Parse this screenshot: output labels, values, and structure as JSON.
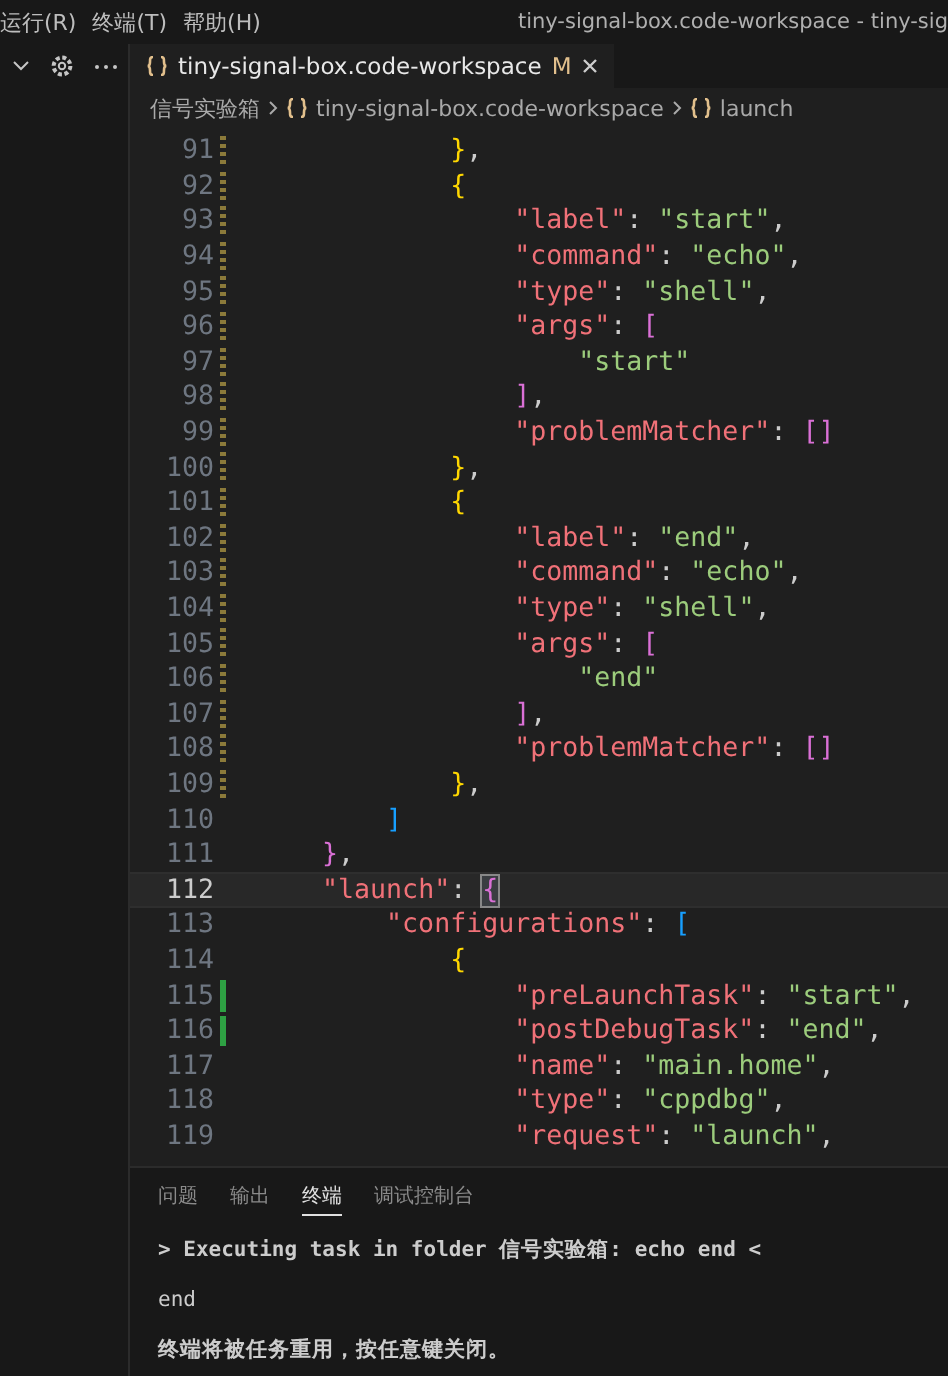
{
  "menu": [
    "运行(R)",
    "终端(T)",
    "帮助(H)"
  ],
  "window": {
    "title": "tiny-signal-box.code-workspace - tiny-sig"
  },
  "tabs": [
    {
      "label": "tiny-signal-box.code-workspace",
      "badge": "M",
      "selected": true
    }
  ],
  "breadcrumb": [
    {
      "label": "信号实验箱",
      "icon": false
    },
    {
      "label": "tiny-signal-box.code-workspace",
      "icon": true
    },
    {
      "label": "launch",
      "icon": true
    }
  ],
  "editor": {
    "lines": [
      {
        "number": "91",
        "modified": true,
        "tokens": [
          {
            "t": "}",
            "kind": "b1"
          },
          {
            "t": ","
          }
        ]
      },
      {
        "number": "92",
        "modified": true,
        "tokens": [
          {
            "t": "{",
            "kind": "b1"
          }
        ]
      },
      {
        "number": "93",
        "modified": true,
        "tokens": [
          {
            "t": "\"label\"",
            "kind": "key"
          },
          {
            "t": ": "
          },
          {
            "t": "\"start\"",
            "kind": "str"
          },
          {
            "t": ","
          }
        ]
      },
      {
        "number": "94",
        "modified": true,
        "tokens": [
          {
            "t": "\"command\"",
            "kind": "key"
          },
          {
            "t": ": "
          },
          {
            "t": "\"echo\"",
            "kind": "str"
          },
          {
            "t": ","
          }
        ]
      },
      {
        "number": "95",
        "modified": true,
        "tokens": [
          {
            "t": "\"type\"",
            "kind": "key"
          },
          {
            "t": ": "
          },
          {
            "t": "\"shell\"",
            "kind": "str"
          },
          {
            "t": ","
          }
        ]
      },
      {
        "number": "96",
        "modified": true,
        "tokens": [
          {
            "t": "\"args\"",
            "kind": "key"
          },
          {
            "t": ": "
          },
          {
            "t": "[",
            "kind": "b2"
          }
        ]
      },
      {
        "number": "97",
        "modified": true,
        "tokens": [
          {
            "t": "\"start\"",
            "kind": "str"
          }
        ]
      },
      {
        "number": "98",
        "modified": true,
        "tokens": [
          {
            "t": "]",
            "kind": "b2"
          },
          {
            "t": ","
          }
        ]
      },
      {
        "number": "99",
        "modified": true,
        "tokens": [
          {
            "t": "\"problemMatcher\"",
            "kind": "key"
          },
          {
            "t": ": "
          },
          {
            "t": "[]",
            "kind": "b2"
          }
        ]
      },
      {
        "number": "100",
        "modified": true,
        "tokens": [
          {
            "t": "}",
            "kind": "b1"
          },
          {
            "t": ","
          }
        ]
      },
      {
        "number": "101",
        "modified": true,
        "tokens": [
          {
            "t": "{",
            "kind": "b1"
          }
        ]
      },
      {
        "number": "102",
        "modified": true,
        "tokens": [
          {
            "t": "\"label\"",
            "kind": "key"
          },
          {
            "t": ": "
          },
          {
            "t": "\"end\"",
            "kind": "str"
          },
          {
            "t": ","
          }
        ]
      },
      {
        "number": "103",
        "modified": true,
        "tokens": [
          {
            "t": "\"command\"",
            "kind": "key"
          },
          {
            "t": ": "
          },
          {
            "t": "\"echo\"",
            "kind": "str"
          },
          {
            "t": ","
          }
        ]
      },
      {
        "number": "104",
        "modified": true,
        "tokens": [
          {
            "t": "\"type\"",
            "kind": "key"
          },
          {
            "t": ": "
          },
          {
            "t": "\"shell\"",
            "kind": "str"
          },
          {
            "t": ","
          }
        ]
      },
      {
        "number": "105",
        "modified": true,
        "tokens": [
          {
            "t": "\"args\"",
            "kind": "key"
          },
          {
            "t": ": "
          },
          {
            "t": "[",
            "kind": "b2"
          }
        ]
      },
      {
        "number": "106",
        "modified": true,
        "tokens": [
          {
            "t": "\"end\"",
            "kind": "str"
          }
        ]
      },
      {
        "number": "107",
        "modified": true,
        "tokens": [
          {
            "t": "]",
            "kind": "b2"
          },
          {
            "t": ","
          }
        ]
      },
      {
        "number": "108",
        "modified": true,
        "tokens": [
          {
            "t": "\"problemMatcher\"",
            "kind": "key"
          },
          {
            "t": ": "
          },
          {
            "t": "[]",
            "kind": "b2"
          }
        ]
      },
      {
        "number": "109",
        "modified": true,
        "tokens": [
          {
            "t": "}",
            "kind": "b1"
          },
          {
            "t": ","
          }
        ]
      },
      {
        "number": "110",
        "tokens": [
          {
            "t": "]",
            "kind": "b3"
          }
        ]
      },
      {
        "number": "111",
        "tokens": [
          {
            "t": "}",
            "kind": "b2"
          },
          {
            "t": ","
          }
        ]
      },
      {
        "number": "112",
        "current": true,
        "tokens": [
          {
            "t": "\"launch\"",
            "kind": "key"
          },
          {
            "t": ": "
          },
          {
            "t": "{",
            "kind": "b2",
            "matched": true
          }
        ]
      },
      {
        "number": "113",
        "tokens": [
          {
            "t": "\"configurations\"",
            "kind": "key"
          },
          {
            "t": ": "
          },
          {
            "t": "[",
            "kind": "b3"
          }
        ]
      },
      {
        "number": "114",
        "tokens": [
          {
            "t": "{",
            "kind": "b1"
          }
        ]
      },
      {
        "number": "115",
        "added": true,
        "tokens": [
          {
            "t": "\"preLaunchTask\"",
            "kind": "key"
          },
          {
            "t": ": "
          },
          {
            "t": "\"start\"",
            "kind": "str"
          },
          {
            "t": ","
          }
        ]
      },
      {
        "number": "116",
        "added": true,
        "tokens": [
          {
            "t": "\"postDebugTask\"",
            "kind": "key"
          },
          {
            "t": ": "
          },
          {
            "t": "\"end\"",
            "kind": "str"
          },
          {
            "t": ","
          }
        ]
      },
      {
        "number": "117",
        "tokens": [
          {
            "t": "\"name\"",
            "kind": "key"
          },
          {
            "t": ": "
          },
          {
            "t": "\"main.home\"",
            "kind": "str"
          },
          {
            "t": ","
          }
        ]
      },
      {
        "number": "118",
        "tokens": [
          {
            "t": "\"type\"",
            "kind": "key"
          },
          {
            "t": ": "
          },
          {
            "t": "\"cppdbg\"",
            "kind": "str"
          },
          {
            "t": ","
          }
        ]
      },
      {
        "number": "119",
        "tokens": [
          {
            "t": "\"request\"",
            "kind": "key"
          },
          {
            "t": ": "
          },
          {
            "t": "\"launch\"",
            "kind": "str"
          },
          {
            "t": ","
          }
        ]
      }
    ]
  },
  "panel": {
    "tabs": [
      {
        "label": "问题",
        "selected": false
      },
      {
        "label": "输出",
        "selected": false
      },
      {
        "label": "终端",
        "selected": true
      },
      {
        "label": "调试控制台",
        "selected": false
      }
    ],
    "terminal": [
      {
        "text": "> Executing task in folder 信号实验箱: echo end <",
        "bold": true
      },
      {
        "text": "end",
        "bold": false
      },
      {
        "text": "终端将被任务重用，按任意键关闭。",
        "bold": true
      }
    ]
  }
}
